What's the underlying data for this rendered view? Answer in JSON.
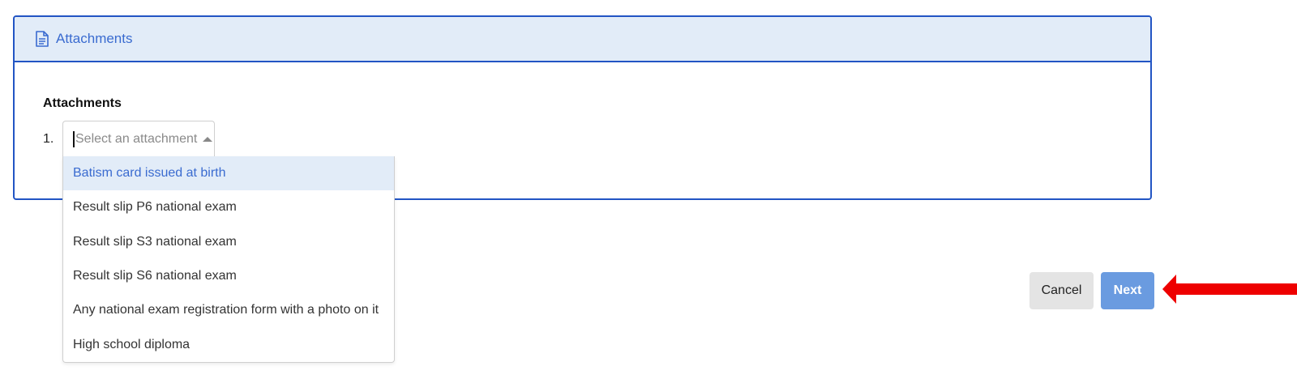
{
  "card": {
    "title": "Attachments",
    "icon": "file-text-icon"
  },
  "field": {
    "label": "Attachments",
    "item_number": "1.",
    "placeholder": "Select an attachment"
  },
  "dropdown": {
    "options": [
      "Batism card issued at birth",
      "Result slip P6 national exam",
      "Result slip S3 national exam",
      "Result slip S6 national exam",
      "Any national exam registration form with a photo on it",
      "High school diploma"
    ],
    "highlighted_index": 0
  },
  "buttons": {
    "cancel": "Cancel",
    "next": "Next"
  },
  "colors": {
    "primary_border": "#2255c4",
    "header_bg": "#e2ecf8",
    "title_text": "#3a6bd0",
    "next_button": "#6a9be0",
    "cancel_button": "#e4e4e4",
    "annotation_arrow": "#ee0000"
  }
}
